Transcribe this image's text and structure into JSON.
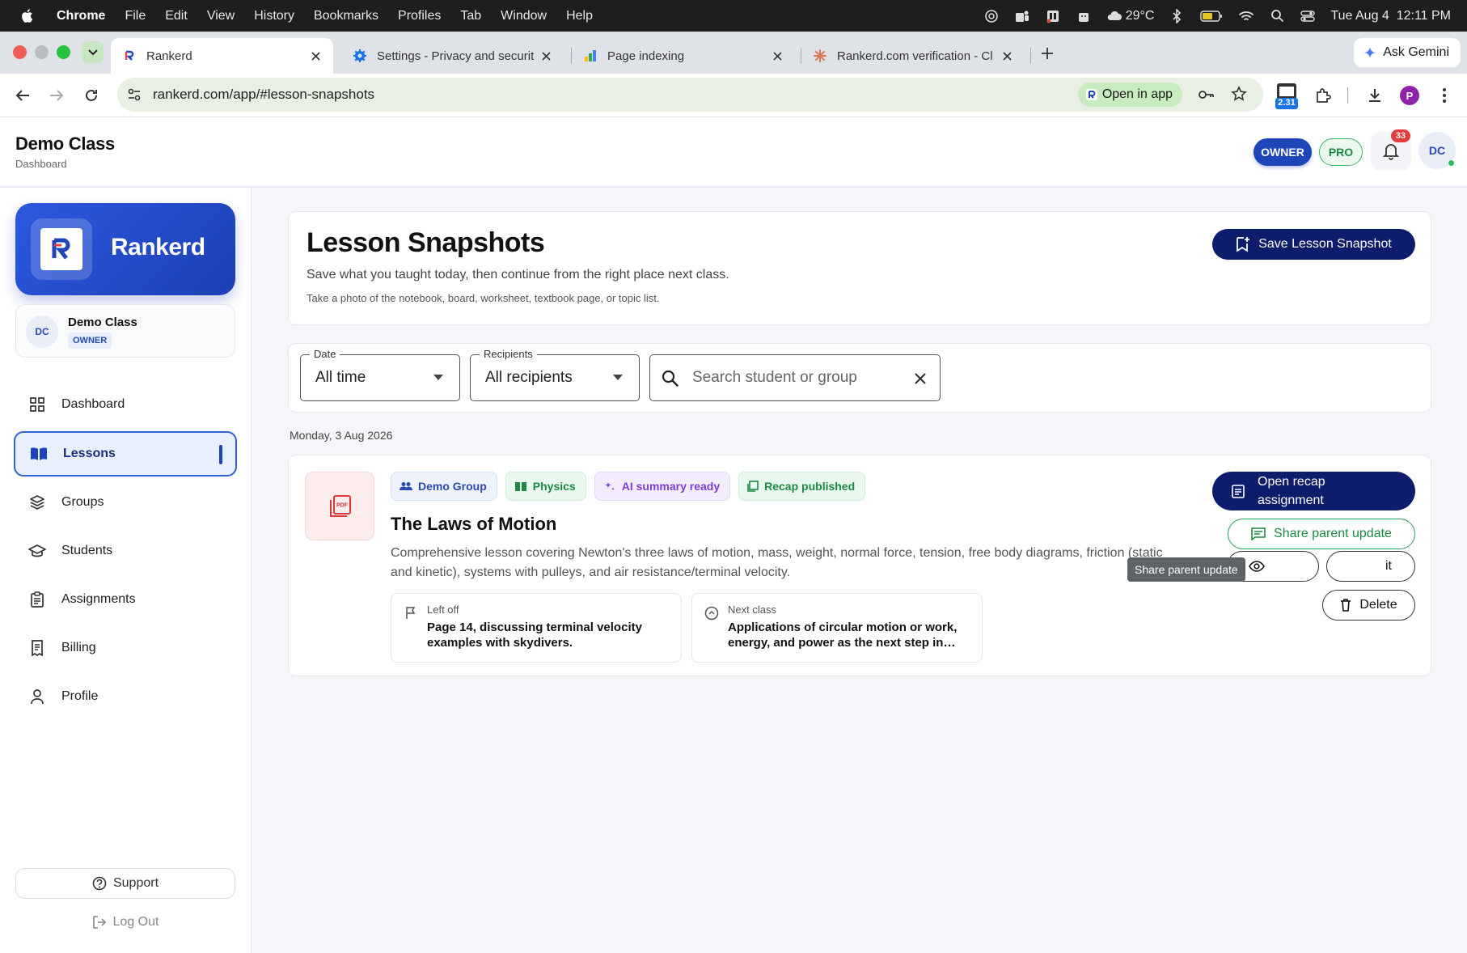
{
  "menubar": {
    "app": "Chrome",
    "items": [
      "File",
      "Edit",
      "View",
      "History",
      "Bookmarks",
      "Profiles",
      "Tab",
      "Window",
      "Help"
    ],
    "weather": "29°C",
    "datetime": "Tue Aug 4  12:11 PM"
  },
  "tabs": [
    {
      "title": "Rankerd",
      "icon": "rankerd-logo-icon",
      "active": true
    },
    {
      "title": "Settings - Privacy and securit",
      "icon": "gear-icon",
      "active": false
    },
    {
      "title": "Page indexing",
      "icon": "search-console-icon",
      "active": false
    },
    {
      "title": "Rankerd.com verification - Cl",
      "icon": "claude-icon",
      "active": false
    }
  ],
  "browser": {
    "gemini_label": "Ask Gemini",
    "url": "rankerd.com/app/#lesson-snapshots",
    "open_in_app": "Open in app",
    "ext_badge": "2.31",
    "profile_initial": "P"
  },
  "header": {
    "class_name": "Demo Class",
    "breadcrumb": "Dashboard",
    "role_pill": "OWNER",
    "plan_pill": "PRO",
    "notification_count": "33",
    "avatar_initials": "DC"
  },
  "sidebar": {
    "brand": "Rankerd",
    "org": {
      "initials": "DC",
      "name": "Demo Class",
      "role": "OWNER"
    },
    "items": [
      {
        "label": "Dashboard",
        "icon": "dashboard-grid-icon"
      },
      {
        "label": "Lessons",
        "icon": "book-open-icon",
        "active": true
      },
      {
        "label": "Groups",
        "icon": "layers-icon"
      },
      {
        "label": "Students",
        "icon": "graduation-cap-icon"
      },
      {
        "label": "Assignments",
        "icon": "clipboard-icon"
      },
      {
        "label": "Billing",
        "icon": "receipt-icon"
      },
      {
        "label": "Profile",
        "icon": "person-icon"
      }
    ],
    "support": "Support",
    "logout": "Log Out"
  },
  "page": {
    "title": "Lesson Snapshots",
    "subtitle": "Save what you taught today, then continue from the right place next class.",
    "hint": "Take a photo of the notebook, board, worksheet, textbook page, or topic list.",
    "save_button": "Save Lesson Snapshot"
  },
  "filters": {
    "date": {
      "label": "Date",
      "value": "All time"
    },
    "recipients": {
      "label": "Recipients",
      "value": "All recipients"
    },
    "search": {
      "placeholder": "Search student or group"
    }
  },
  "date_heading": "Monday, 3 Aug 2026",
  "lesson": {
    "tags": {
      "group": "Demo Group",
      "subject": "Physics",
      "ai": "AI summary ready",
      "recap": "Recap published"
    },
    "title": "The Laws of Motion",
    "description": "Comprehensive lesson covering Newton's three laws of motion, mass, weight, normal force, tension, free body diagrams, friction (static and kinetic), systems with pulleys, and air resistance/terminal velocity.",
    "left_off": {
      "label": "Left off",
      "text": "Page 14, discussing terminal velocity examples with skydivers."
    },
    "next_class": {
      "label": "Next class",
      "text": "Applications of circular motion or work, energy, and power as the next step in clas…"
    },
    "actions": {
      "open_recap": "Open recap assignment",
      "share_parent": "Share parent update",
      "edit_partial": "it",
      "delete": "Delete"
    },
    "tooltip": "Share parent update"
  },
  "colors": {
    "brand_blue": "#1f46b8",
    "navy": "#0e1d6b",
    "success_green": "#1d8a44",
    "ai_purple": "#7b3fd6",
    "danger_red": "#e63b3b"
  }
}
